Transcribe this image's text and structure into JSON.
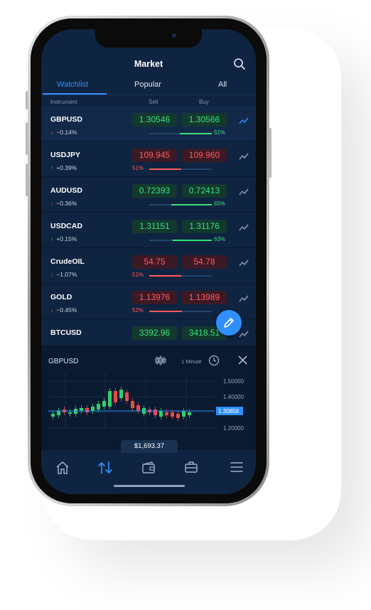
{
  "app": {
    "title": "Market",
    "tabs": [
      {
        "label": "Watchlist",
        "active": true
      },
      {
        "label": "Popular",
        "active": false
      },
      {
        "label": "All",
        "active": false
      }
    ],
    "columns": {
      "instrument": "Instrument",
      "sell": "Sell",
      "buy": "Buy"
    }
  },
  "watchlist": [
    {
      "symbol": "GBPUSD",
      "direction": "down",
      "change": "−0.14%",
      "sell": "1.30546",
      "buy": "1.30566",
      "color": "green",
      "pct": "51%",
      "pct_value": 51,
      "active_icon": true
    },
    {
      "symbol": "USDJPY",
      "direction": "up",
      "change": "+0.39%",
      "sell": "109.945",
      "buy": "109.960",
      "color": "red",
      "pct": "51%",
      "pct_value": 51,
      "active_icon": false
    },
    {
      "symbol": "AUDUSD",
      "direction": "down",
      "change": "−0.36%",
      "sell": "0.72393",
      "buy": "0.72413",
      "color": "green",
      "pct": "65%",
      "pct_value": 65,
      "active_icon": false
    },
    {
      "symbol": "USDCAD",
      "direction": "up",
      "change": "+0.15%",
      "sell": "1.31151",
      "buy": "1.31176",
      "color": "green",
      "pct": "63%",
      "pct_value": 63,
      "active_icon": false
    },
    {
      "symbol": "CrudeOIL",
      "direction": "down",
      "change": "−1.07%",
      "sell": "54.75",
      "buy": "54.78",
      "color": "red",
      "pct": "51%",
      "pct_value": 51,
      "active_icon": false
    },
    {
      "symbol": "GOLD",
      "direction": "down",
      "change": "−0.45%",
      "sell": "1.13976",
      "buy": "1.13989",
      "color": "red",
      "pct": "52%",
      "pct_value": 52,
      "active_icon": false
    },
    {
      "symbol": "BTCUSD",
      "sell": "3392.96",
      "buy": "3418.51",
      "color": "green",
      "active_icon": false
    }
  ],
  "chart_panel": {
    "symbol": "GBPUSD",
    "interval": "1 Minute",
    "current_price": "1.30858",
    "y_ticks": [
      "1.50000",
      "1.40000",
      "1.20000"
    ],
    "x_ticks": [
      "Jul",
      "2018",
      "Jul",
      "2019"
    ]
  },
  "balance": "$1,693.37",
  "nav": [
    {
      "name": "home-icon",
      "active": false
    },
    {
      "name": "trade-arrows-icon",
      "active": true
    },
    {
      "name": "wallet-icon",
      "active": false
    },
    {
      "name": "briefcase-icon",
      "active": false
    },
    {
      "name": "menu-icon",
      "active": false
    }
  ],
  "colors": {
    "accent": "#2f8fff",
    "background": "#0f2440",
    "positive": "#38e07a",
    "negative": "#ff5a5a"
  }
}
